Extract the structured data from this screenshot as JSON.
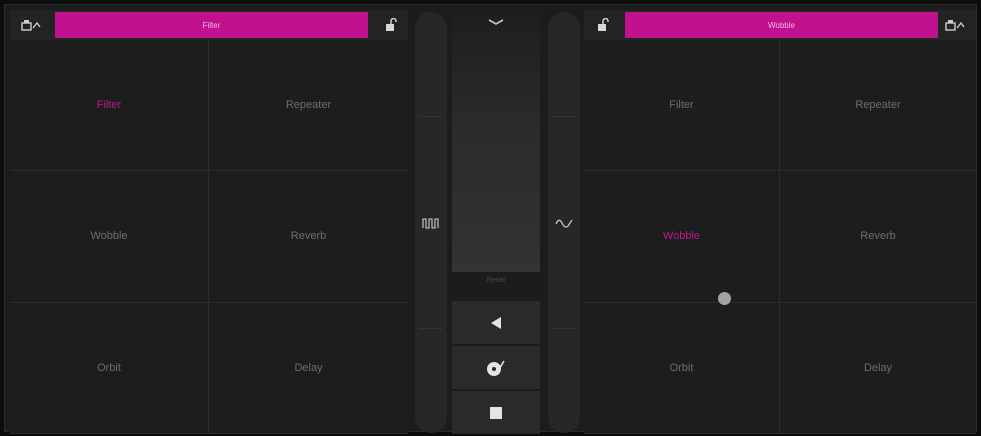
{
  "left_panel": {
    "title": "Filter",
    "cells": [
      "Filter",
      "Repeater",
      "Wobble",
      "Reverb",
      "Orbit",
      "Delay"
    ],
    "active": "Filter"
  },
  "right_panel": {
    "title": "Wobble",
    "cells": [
      "Filter",
      "Repeater",
      "Wobble",
      "Reverb",
      "Orbit",
      "Delay"
    ],
    "active": "Wobble"
  },
  "center": {
    "reset_label": "Reset",
    "icons": {
      "left_slider": "square-wave-icon",
      "right_slider": "sine-wave-icon",
      "collapse": "chevron-down-icon",
      "play": "play-back-icon",
      "sync": "vinyl-icon",
      "stop": "stop-icon"
    }
  },
  "colors": {
    "accent": "#c1118f",
    "active_text": "#c21594"
  }
}
